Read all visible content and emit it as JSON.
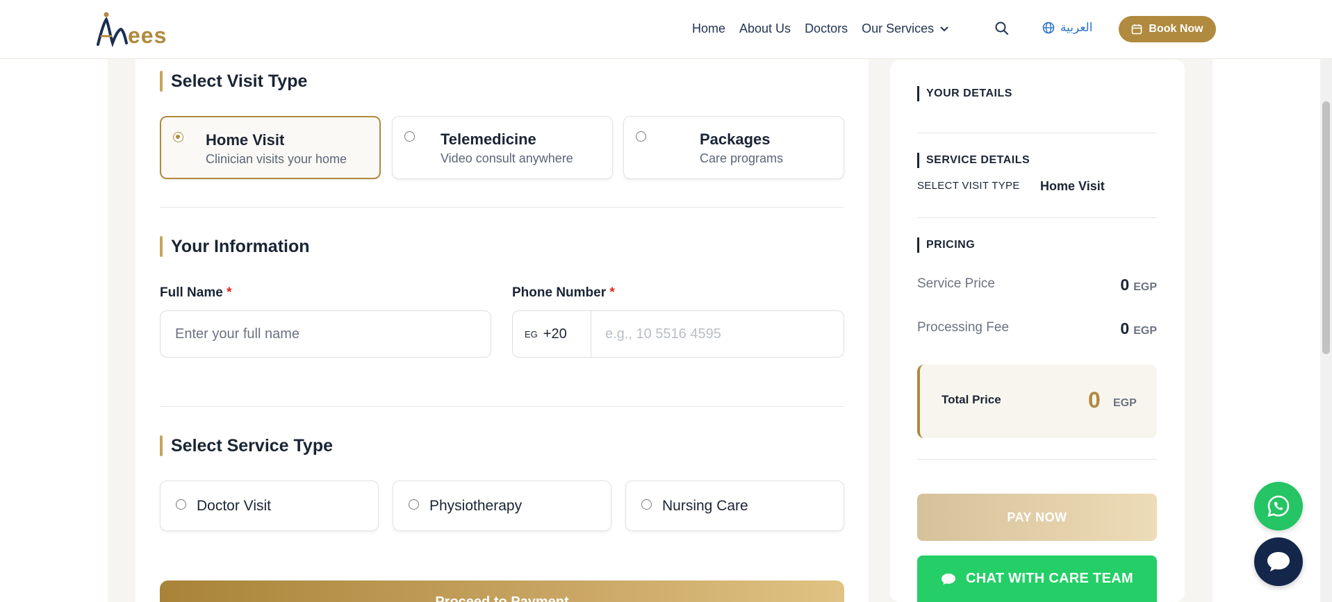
{
  "header": {
    "logo_text": "ees",
    "nav": [
      "Home",
      "About Us",
      "Doctors",
      "Our Services"
    ],
    "language": "العربية",
    "book_label": "Book Now"
  },
  "visit_type": {
    "title": "Select Visit Type",
    "options": [
      {
        "title": "Home Visit",
        "subtitle": "Clinician visits your home",
        "selected": true
      },
      {
        "title": "Telemedicine",
        "subtitle": "Video consult anywhere",
        "selected": false
      },
      {
        "title": "Packages",
        "subtitle": "Care programs",
        "selected": false
      }
    ]
  },
  "info": {
    "title": "Your Information",
    "full_name_label": "Full Name",
    "full_name_placeholder": "Enter your full name",
    "phone_label": "Phone Number",
    "required_mark": "*",
    "country_code": "EG",
    "dial_code": "+20",
    "phone_placeholder": "e.g., 10 5516 4595"
  },
  "service_type": {
    "title": "Select Service Type",
    "options": [
      "Doctor Visit",
      "Physiotherapy",
      "Nursing Care"
    ]
  },
  "proceed_label": "Proceed to Payment",
  "sidebar": {
    "your_details": "YOUR DETAILS",
    "service_details": "SERVICE DETAILS",
    "visit_type_key": "SELECT VISIT TYPE",
    "visit_type_value": "Home Visit",
    "pricing": "PRICING",
    "service_price_label": "Service Price",
    "service_price": "0",
    "processing_fee_label": "Processing Fee",
    "processing_fee": "0",
    "currency": "EGP",
    "total_label": "Total Price",
    "total": "0",
    "pay_label": "PAY NOW",
    "chat_label": "CHAT WITH CARE TEAM"
  },
  "colors": {
    "accent": "#b08a3e",
    "whatsapp": "#25c464",
    "chat_fab": "#14274a",
    "chat_button": "#23cf66"
  }
}
